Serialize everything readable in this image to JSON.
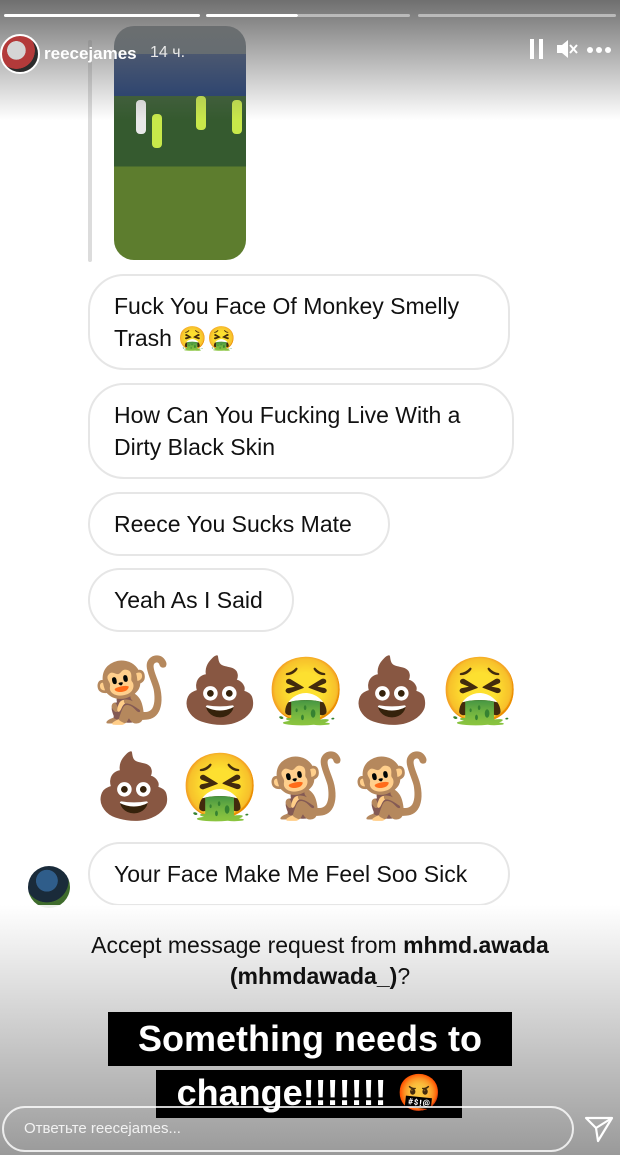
{
  "story": {
    "username": "reecejames",
    "time": "14 ч.",
    "progress_total": 3,
    "progress_current": 2,
    "icons": {
      "pause": "pause-icon",
      "mute": "mute-icon",
      "more": "more-icon"
    }
  },
  "messages": [
    {
      "text": "Fuck You Face Of Monkey Smelly Trash 🤮🤮"
    },
    {
      "text": "How Can You Fucking Live With a Dirty Black Skin"
    },
    {
      "text": "Reece You Sucks Mate"
    },
    {
      "text": "Yeah As I Said"
    }
  ],
  "emoji_rows": [
    [
      "🐒",
      "💩",
      "🤮",
      "💩",
      "🤮"
    ],
    [
      "💩",
      "🤮",
      "🐒",
      "🐒"
    ]
  ],
  "last_message": {
    "text": "Your Face Make Me Feel Soo Sick"
  },
  "request": {
    "prefix": "Accept message request from ",
    "account": "mhmd.awada",
    "handle": "(mhmdawada_)",
    "suffix": "?"
  },
  "caption": {
    "line1": "Something needs to",
    "line2": "change!!!!!!! 🤬"
  },
  "reply_placeholder": "Ответьте reecejames...",
  "colors": {
    "bubble_border": "#e6e6e6",
    "caption_bg": "#000000",
    "caption_text": "#ffffff"
  }
}
